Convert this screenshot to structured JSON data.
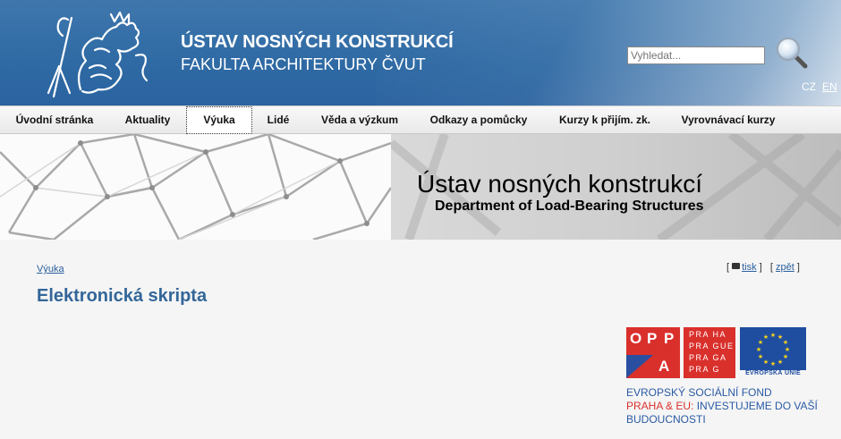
{
  "header": {
    "title": "ÚSTAV NOSNÝCH KONSTRUKCÍ",
    "subtitle": "FAKULTA ARCHITEKTURY ČVUT",
    "search_placeholder": "Vyhledat...",
    "lang_cz": "CZ",
    "lang_en": "EN"
  },
  "menu": {
    "items": [
      {
        "label": "Úvodní stránka"
      },
      {
        "label": "Aktuality"
      },
      {
        "label": "Výuka"
      },
      {
        "label": "Lidé"
      },
      {
        "label": "Věda a výzkum"
      },
      {
        "label": "Odkazy a pomůcky"
      },
      {
        "label": "Kurzy k přijím. zk."
      },
      {
        "label": "Vyrovnávací kurzy"
      }
    ],
    "active_index": 2
  },
  "banner": {
    "title": "Ústav nosných konstrukcí",
    "subtitle": "Department of Load-Bearing Structures"
  },
  "content": {
    "breadcrumb": "Výuka",
    "page_title": "Elektronická skripta",
    "print_label": "tisk",
    "back_label": "zpět",
    "bracket_open": "[",
    "bracket_close": "]"
  },
  "esf": {
    "opp_letters": [
      "O",
      "P",
      "P",
      "A"
    ],
    "praha_rows": [
      "PRA HA",
      "PRA GUE",
      "PRA GA",
      "PRA G"
    ],
    "eu_label": "EVROPSKÁ UNIE",
    "line1": "EVROPSKÝ SOCIÁLNÍ FOND",
    "line2_red": "PRAHA & EU:",
    "line2_blue": "INVESTUJEME DO VAŠÍ",
    "line3": "BUDOUCNOSTI"
  },
  "colors": {
    "header_blue": "#2f6aa4",
    "title_blue": "#336699",
    "link_blue": "#2a5f9e",
    "esf_red": "#d9302c",
    "eu_blue": "#1f4ea1"
  }
}
